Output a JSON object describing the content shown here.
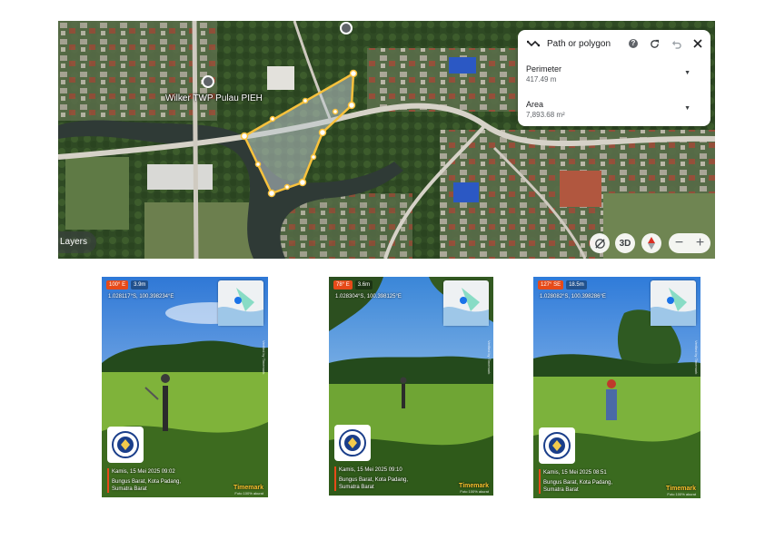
{
  "map": {
    "poi_label": "Wilker TWP Pulau PIEH",
    "layers_label": "Layers",
    "view_3d_label": "3D",
    "icons": {
      "poi": "map-pin-icon",
      "satellite": "satellite-off-icon",
      "compass": "compass-icon",
      "zoom_out": "minus-icon",
      "zoom_in": "plus-icon"
    },
    "colors": {
      "polygon": "#f9c23c",
      "compass_needle": "#d93025"
    }
  },
  "measure_panel": {
    "title": "Path or polygon",
    "help": "?",
    "perimeter": {
      "label": "Perimeter",
      "value": "417.49 m"
    },
    "area": {
      "label": "Area",
      "value": "7,893.68 m²"
    }
  },
  "photos": [
    {
      "compass": "100° E",
      "altitude": "3.9m",
      "coords": "1.028117°S, 100.398234°E",
      "date_time": "Kamis, 15 Mei 2025 09:02",
      "address": [
        "Bungus Barat, Kota Padang,",
        "Sumatra Barat"
      ],
      "brand": "Timemark",
      "brand_sub": "Foto 100% akurat",
      "side_text": "Verified by Timemark"
    },
    {
      "compass": "78° E",
      "altitude": "3.6m",
      "coords": "1.028304°S, 100.398125°E",
      "date_time": "Kamis, 15 Mei 2025 09:10",
      "address": [
        "Bungus Barat, Kota Padang,",
        "Sumatra Barat"
      ],
      "brand": "Timemark",
      "brand_sub": "Foto 100% akurat",
      "side_text": "Verified by Timemark"
    },
    {
      "compass": "127° SE",
      "altitude": "18.5m",
      "coords": "1.028082°S, 100.398286°E",
      "date_time": "Kamis, 15 Mei 2025 08:51",
      "address": [
        "Bungus Barat, Kota Padang,",
        "Sumatra Barat"
      ],
      "brand": "Timemark",
      "brand_sub": "Foto 100% akurat",
      "side_text": "Verified by Timemark"
    }
  ]
}
